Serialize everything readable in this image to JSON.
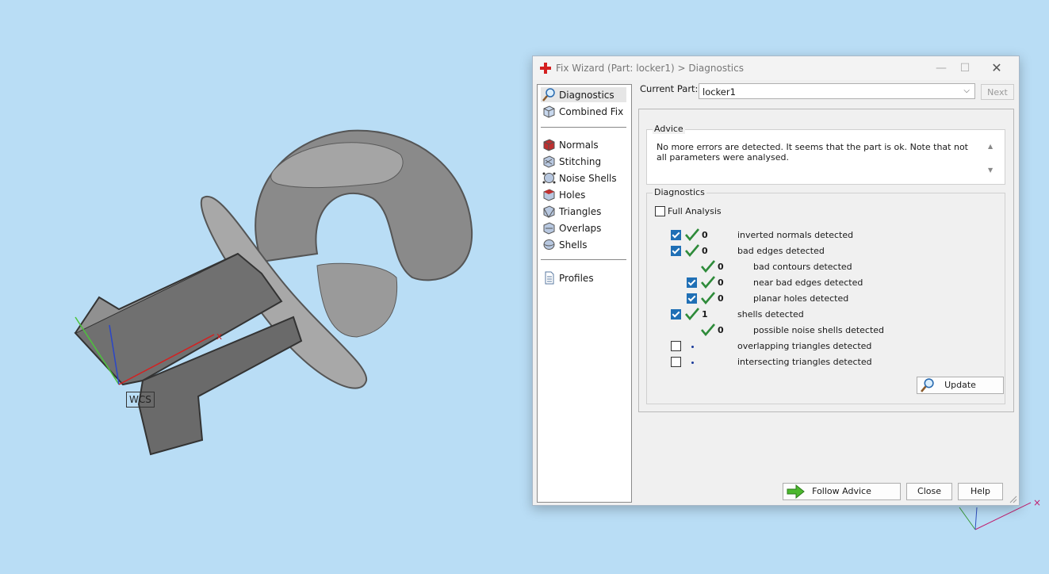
{
  "viewport": {
    "background": "#b9ddf5",
    "wcs_label": "WCS",
    "axis_x_label": "x"
  },
  "dialog": {
    "title": "Fix Wizard (Part: locker1) > Diagnostics",
    "title_icon": "red-cross-icon",
    "window_buttons": {
      "minimize": "—",
      "maximize": "☐",
      "close": "✕"
    },
    "nav": {
      "group1": [
        {
          "label": "Diagnostics",
          "icon": "magnifier-icon",
          "selected": true
        },
        {
          "label": "Combined Fix",
          "icon": "cube-icon",
          "selected": false
        }
      ],
      "group2": [
        {
          "label": "Normals",
          "icon": "normals-cube-icon"
        },
        {
          "label": "Stitching",
          "icon": "stitching-cube-icon"
        },
        {
          "label": "Noise Shells",
          "icon": "noise-shells-icon"
        },
        {
          "label": "Holes",
          "icon": "holes-cube-icon"
        },
        {
          "label": "Triangles",
          "icon": "triangles-cube-icon"
        },
        {
          "label": "Overlaps",
          "icon": "overlaps-cube-icon"
        },
        {
          "label": "Shells",
          "icon": "shells-icon"
        }
      ],
      "group3": [
        {
          "label": "Profiles",
          "icon": "document-icon"
        }
      ]
    },
    "current_part": {
      "label": "Current Part:",
      "value": "locker1"
    },
    "next_label": "Next",
    "advice": {
      "title": "Advice",
      "text": "No more errors are detected. It seems that the part is ok. Note that not all parameters were analysed."
    },
    "diagnostics": {
      "title": "Diagnostics",
      "full_analysis_label": "Full Analysis",
      "full_analysis_checked": false,
      "rows": [
        {
          "checked": true,
          "status": "ok",
          "count": "0",
          "label": "inverted normals detected",
          "indent": 0
        },
        {
          "checked": true,
          "status": "ok",
          "count": "0",
          "label": "bad edges detected",
          "indent": 0
        },
        {
          "checked": null,
          "status": "ok",
          "count": "0",
          "label": "bad contours detected",
          "indent": 1
        },
        {
          "checked": true,
          "status": "ok",
          "count": "0",
          "label": "near bad edges detected",
          "indent": 1
        },
        {
          "checked": true,
          "status": "ok",
          "count": "0",
          "label": "planar holes detected",
          "indent": 1
        },
        {
          "checked": true,
          "status": "ok",
          "count": "1",
          "label": "shells detected",
          "indent": 0
        },
        {
          "checked": null,
          "status": "ok",
          "count": "0",
          "label": "possible noise shells detected",
          "indent": 1
        },
        {
          "checked": false,
          "status": "pending",
          "count": "",
          "label": "overlapping triangles detected",
          "indent": 0
        },
        {
          "checked": false,
          "status": "pending",
          "count": "",
          "label": "intersecting triangles detected",
          "indent": 0
        }
      ],
      "update_label": "Update"
    },
    "buttons": {
      "follow_advice": "Follow Advice",
      "close": "Close",
      "help": "Help"
    },
    "colors": {
      "check_green": "#2e8b3a",
      "accent_blue": "#1f6fb5"
    }
  }
}
